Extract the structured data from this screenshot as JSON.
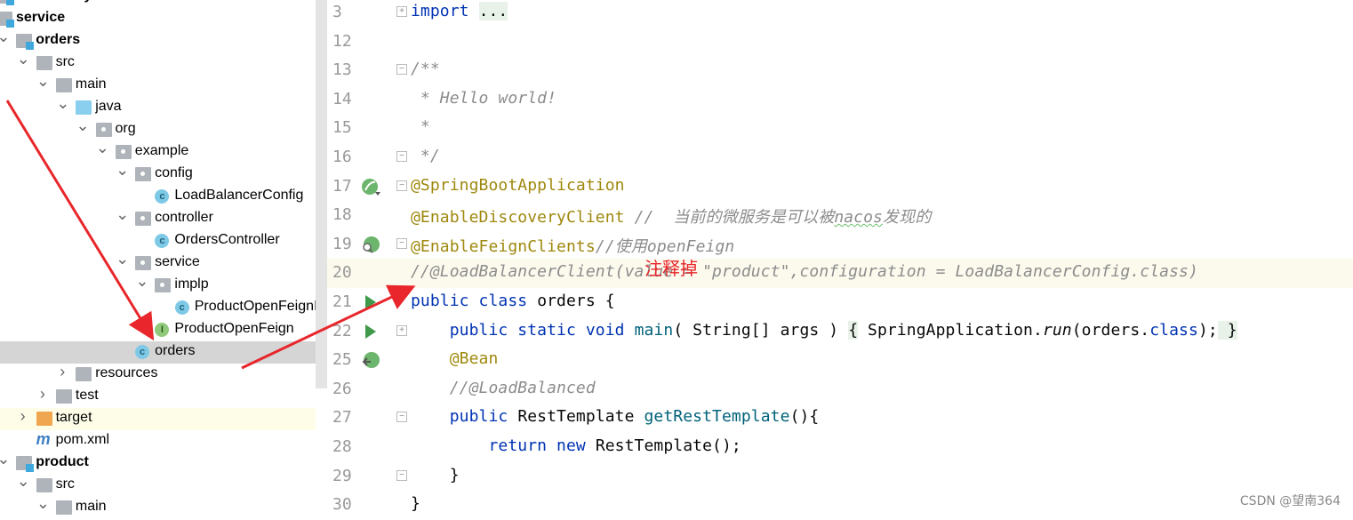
{
  "project_tree": {
    "items": [
      {
        "label": "commodity",
        "level": 0,
        "icon": "module-folder-icon",
        "expanded": null,
        "bold": true
      },
      {
        "label": "service",
        "level": 0,
        "icon": "module-folder-icon",
        "expanded": true,
        "bold": true
      },
      {
        "label": "orders",
        "level": 1,
        "icon": "module-folder-icon",
        "expanded": true,
        "bold": true
      },
      {
        "label": "src",
        "level": 2,
        "icon": "folder-icon",
        "expanded": true
      },
      {
        "label": "main",
        "level": 3,
        "icon": "folder-icon",
        "expanded": true
      },
      {
        "label": "java",
        "level": 4,
        "icon": "source-folder-icon",
        "expanded": true
      },
      {
        "label": "org",
        "level": 5,
        "icon": "package-icon",
        "expanded": true
      },
      {
        "label": "example",
        "level": 6,
        "icon": "package-icon",
        "expanded": true
      },
      {
        "label": "config",
        "level": 7,
        "icon": "package-icon",
        "expanded": true
      },
      {
        "label": "LoadBalancerConfig",
        "level": 8,
        "icon": "class-icon"
      },
      {
        "label": "controller",
        "level": 7,
        "icon": "package-icon",
        "expanded": true
      },
      {
        "label": "OrdersController",
        "level": 8,
        "icon": "class-icon"
      },
      {
        "label": "service",
        "level": 7,
        "icon": "package-icon",
        "expanded": true
      },
      {
        "label": "implp",
        "level": 8,
        "icon": "package-icon",
        "expanded": true
      },
      {
        "label": "ProductOpenFeignImpl",
        "level": 9,
        "icon": "class-icon"
      },
      {
        "label": "ProductOpenFeign",
        "level": 8,
        "icon": "interface-icon"
      },
      {
        "label": "orders",
        "level": 7,
        "icon": "spring-boot-class-icon",
        "selected": true
      },
      {
        "label": "resources",
        "level": 4,
        "icon": "resources-folder-icon",
        "expanded": false
      },
      {
        "label": "test",
        "level": 3,
        "icon": "folder-icon",
        "expanded": false
      },
      {
        "label": "target",
        "level": 2,
        "icon": "excluded-folder-icon",
        "expanded": false,
        "highlighted": true
      },
      {
        "label": "pom.xml",
        "level": 2,
        "icon": "maven-icon"
      },
      {
        "label": "product",
        "level": 1,
        "icon": "module-folder-icon",
        "expanded": true,
        "bold": true
      },
      {
        "label": "src",
        "level": 2,
        "icon": "folder-icon",
        "expanded": true
      },
      {
        "label": "main",
        "level": 3,
        "icon": "folder-icon",
        "expanded": true
      }
    ]
  },
  "editor": {
    "current_line": "20",
    "lines": [
      {
        "num": "3",
        "fold": "+",
        "gutter_icon": null,
        "html": [
          [
            "import ",
            "kw"
          ],
          [
            "...",
            "fld"
          ]
        ]
      },
      {
        "num": "12",
        "html": []
      },
      {
        "num": "13",
        "fold": "-",
        "html": [
          [
            "/**",
            "cm"
          ]
        ]
      },
      {
        "num": "14",
        "html": [
          [
            " * Hello world!",
            "cm"
          ]
        ]
      },
      {
        "num": "15",
        "html": [
          [
            " *",
            "cm"
          ]
        ]
      },
      {
        "num": "16",
        "fold": "-",
        "html": [
          [
            " */",
            "cm"
          ]
        ]
      },
      {
        "num": "17",
        "fold": "-",
        "gutter_icon": "spring-bean-icon",
        "html": [
          [
            "@SpringBootApplication",
            "ann"
          ]
        ]
      },
      {
        "num": "18",
        "html": [
          [
            "@EnableDiscoveryClient ",
            "ann"
          ],
          [
            "//  当前的微服务是可以被",
            "cm"
          ],
          [
            "nacos",
            "cm squig"
          ],
          [
            "发现的",
            "cm"
          ]
        ]
      },
      {
        "num": "19",
        "fold": "-",
        "gutter_icon": "spring-search-icon",
        "html": [
          [
            "@EnableFeignClients",
            "ann"
          ],
          [
            "//使用openFeign",
            "cm"
          ]
        ]
      },
      {
        "num": "20",
        "html": [
          [
            "//@LoadBalancerClient(value = \"product\",configuration = LoadBalancerConfig.class)",
            "cm"
          ]
        ]
      },
      {
        "num": "21",
        "gutter_icon": "run-icon",
        "html": [
          [
            "public class ",
            "kw"
          ],
          [
            "orders {",
            ""
          ]
        ]
      },
      {
        "num": "22",
        "fold": "+",
        "gutter_icon": "run-icon",
        "html": [
          [
            "    public static void ",
            "kw"
          ],
          [
            "main",
            "fn"
          ],
          [
            "( String[] args ) ",
            ""
          ],
          [
            "{",
            "fld"
          ],
          [
            " SpringApplication.",
            ""
          ],
          [
            "run",
            "it"
          ],
          [
            "(orders.",
            ""
          ],
          [
            "class",
            "kw"
          ],
          [
            ");",
            ""
          ],
          [
            " }",
            "fld"
          ]
        ]
      },
      {
        "num": "25",
        "gutter_icon": "spring-bean-link-icon",
        "html": [
          [
            "    @Bean",
            "ann"
          ]
        ]
      },
      {
        "num": "26",
        "html": [
          [
            "    //@LoadBalanced",
            "cm"
          ]
        ]
      },
      {
        "num": "27",
        "fold": "-",
        "html": [
          [
            "    public ",
            "kw"
          ],
          [
            "RestTemplate ",
            ""
          ],
          [
            "getRestTemplate",
            "fn"
          ],
          [
            "(){",
            ""
          ]
        ]
      },
      {
        "num": "28",
        "html": [
          [
            "        return new ",
            "kw"
          ],
          [
            "RestTemplate();",
            ""
          ]
        ]
      },
      {
        "num": "29",
        "fold": "-",
        "html": [
          [
            "    }",
            ""
          ]
        ]
      },
      {
        "num": "30",
        "html": [
          [
            "}",
            ""
          ]
        ]
      }
    ]
  },
  "annotation": {
    "text": "注释掉",
    "color": "#e8262b"
  },
  "watermark": "CSDN @望南364",
  "colors": {
    "keyword": "#0033b3",
    "annotation": "#9e880d",
    "comment": "#8c8c8c",
    "selection": "#d5d5d5",
    "current_line": "#fcfaed",
    "arrow": "#e8262b"
  }
}
